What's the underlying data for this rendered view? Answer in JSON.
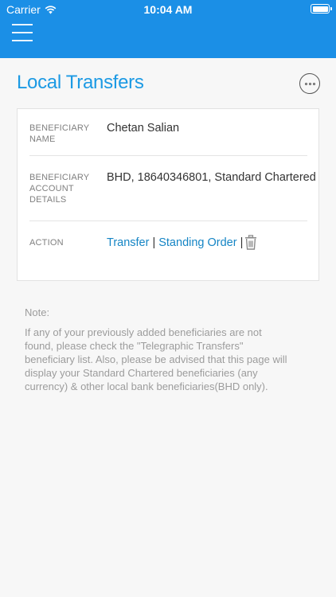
{
  "status_bar": {
    "carrier": "Carrier",
    "time": "10:04 AM"
  },
  "header": {
    "menu_icon": "hamburger-icon",
    "bar_color": "#1b8fe6"
  },
  "page": {
    "title": "Local Transfers",
    "title_color": "#1c9ae4",
    "more_icon": "more-options-icon"
  },
  "beneficiary": {
    "name_label": "BENEFICIARY NAME",
    "name_value": "Chetan Salian",
    "account_label": "BENEFICIARY ACCOUNT DETAILS",
    "account_value": "BHD, 18640346801, Standard Chartered",
    "action_label": "ACTION",
    "actions": {
      "transfer": "Transfer",
      "separator": "|",
      "standing_order": "Standing Order",
      "delete_icon": "trash-icon"
    },
    "link_color": "#1585c5"
  },
  "note": {
    "title": "Note:",
    "body": "If any of your previously added beneficiaries are not found, please check the \"Telegraphic Transfers\" beneficiary list. Also, please be advised that this page will display your Standard Chartered beneficiaries (any currency) & other local bank beneficiaries(BHD only)."
  }
}
